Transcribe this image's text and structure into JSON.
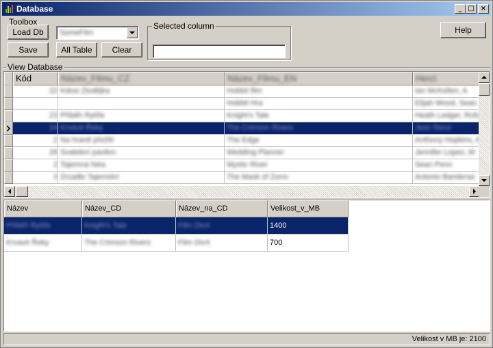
{
  "window": {
    "title": "Database"
  },
  "toolbox": {
    "label": "Toolbox",
    "load_db": "Load Db",
    "save": "Save",
    "all_table": "All Table",
    "clear": "Clear",
    "combo_value": "SomeFilm"
  },
  "selected_column": {
    "label": "Selected column",
    "value": ""
  },
  "help": "Help",
  "view_database": {
    "label": "View Database",
    "columns": [
      "Kód",
      "Název_Filmu_CZ",
      "Název_Filmu_EN",
      "Herci"
    ],
    "rows": [
      {
        "kod": "22",
        "cz": "Kdosi Zlodějka",
        "en": "Hobbit film",
        "herci": "Ian McKellen, A"
      },
      {
        "kod": "",
        "cz": "",
        "en": "Hobbit Hra",
        "herci": "Elijah Wood, Sean"
      },
      {
        "kod": "23",
        "cz": "Příběh Rytíře",
        "en": "Knight's Tale",
        "herci": "Heath Ledger, Rufus"
      },
      {
        "kod": "24",
        "cz": "Krvavé Řeky",
        "en": "The Crimson Rivers",
        "herci": "Jean Reno"
      },
      {
        "kod": "2",
        "cz": "Na hraně přežití",
        "en": "The Edge",
        "herci": "Anthony Hopkins, Alec"
      },
      {
        "kod": "28",
        "cz": "Svatební pavilon",
        "en": "Wedding Planner",
        "herci": "Jennifer Lopez, M"
      },
      {
        "kod": "2",
        "cz": "Tajemná řeka",
        "en": "Mystic River",
        "herci": "Sean Penn"
      },
      {
        "kod": "3",
        "cz": "Zrcadlo Tajemství",
        "en": "The Mask of Zorro",
        "herci": "Antonio Banderas"
      }
    ],
    "selected_row": 3
  },
  "result_grid": {
    "columns": [
      "Název",
      "Název_CD",
      "Název_na_CD",
      "Velikost_v_MB"
    ],
    "rows": [
      {
        "nazev": "Příběh Rytíře",
        "nazev_cd": "Knight's Tale",
        "nazev_na_cd": "Film DivX",
        "velikost": "1400"
      },
      {
        "nazev": "Krvavé Řeky",
        "nazev_cd": "The Crimson Rivers",
        "nazev_na_cd": "Film DivX",
        "velikost": "700"
      }
    ]
  },
  "status": {
    "text": "Velikost v MB je: 2100"
  },
  "colors": {
    "selection": "#0a246a",
    "face": "#d4d0c8",
    "title_gradient_end": "#a6caf0"
  }
}
